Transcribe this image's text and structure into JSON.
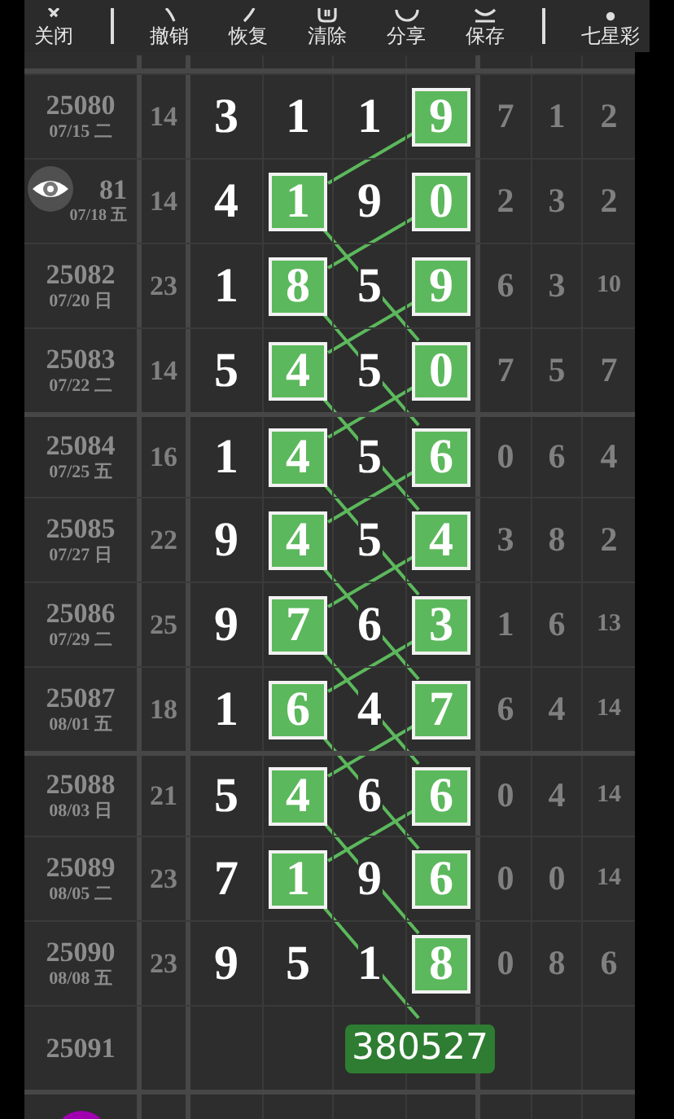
{
  "toolbar": [
    {
      "label": "关闭",
      "separated": true
    },
    {
      "label": "撤销",
      "separated": false
    },
    {
      "label": "恢复",
      "separated": false
    },
    {
      "label": "清除",
      "separated": false
    },
    {
      "label": "分享",
      "separated": false
    },
    {
      "label": "保存",
      "separated": true
    },
    {
      "label": "七星彩",
      "separated": false
    }
  ],
  "rows": [
    {
      "issue": "25080",
      "date": "07/15 二",
      "sum": "14",
      "digits": [
        {
          "value": "3",
          "highlighted": false
        },
        {
          "value": "1",
          "highlighted": false
        },
        {
          "value": "1",
          "highlighted": false
        },
        {
          "value": "9",
          "highlighted": true
        }
      ],
      "tail": [
        "7",
        "1",
        "2"
      ]
    },
    {
      "issue": "81",
      "eye_button": true,
      "date": "07/18 五",
      "sum": "14",
      "digits": [
        {
          "value": "4",
          "highlighted": false
        },
        {
          "value": "1",
          "highlighted": true
        },
        {
          "value": "9",
          "highlighted": false
        },
        {
          "value": "0",
          "highlighted": true
        }
      ],
      "tail": [
        "2",
        "3",
        "2"
      ]
    },
    {
      "issue": "25082",
      "date": "07/20 日",
      "sum": "23",
      "digits": [
        {
          "value": "1",
          "highlighted": false
        },
        {
          "value": "8",
          "highlighted": true
        },
        {
          "value": "5",
          "highlighted": false
        },
        {
          "value": "9",
          "highlighted": true
        }
      ],
      "tail": [
        "6",
        "3",
        "10"
      ]
    },
    {
      "issue": "25083",
      "date": "07/22 二",
      "sum": "14",
      "digits": [
        {
          "value": "5",
          "highlighted": false
        },
        {
          "value": "4",
          "highlighted": true
        },
        {
          "value": "5",
          "highlighted": false
        },
        {
          "value": "0",
          "highlighted": true
        }
      ],
      "tail": [
        "7",
        "5",
        "7"
      ]
    },
    {
      "issue": "25084",
      "date": "07/25 五",
      "sum": "16",
      "digits": [
        {
          "value": "1",
          "highlighted": false
        },
        {
          "value": "4",
          "highlighted": true
        },
        {
          "value": "5",
          "highlighted": false
        },
        {
          "value": "6",
          "highlighted": true
        }
      ],
      "tail": [
        "0",
        "6",
        "4"
      ]
    },
    {
      "issue": "25085",
      "date": "07/27 日",
      "sum": "22",
      "digits": [
        {
          "value": "9",
          "highlighted": false
        },
        {
          "value": "4",
          "highlighted": true
        },
        {
          "value": "5",
          "highlighted": false
        },
        {
          "value": "4",
          "highlighted": true
        }
      ],
      "tail": [
        "3",
        "8",
        "2"
      ]
    },
    {
      "issue": "25086",
      "date": "07/29 二",
      "sum": "25",
      "digits": [
        {
          "value": "9",
          "highlighted": false
        },
        {
          "value": "7",
          "highlighted": true
        },
        {
          "value": "6",
          "highlighted": false
        },
        {
          "value": "3",
          "highlighted": true
        }
      ],
      "tail": [
        "1",
        "6",
        "13"
      ]
    },
    {
      "issue": "25087",
      "date": "08/01 五",
      "sum": "18",
      "digits": [
        {
          "value": "1",
          "highlighted": false
        },
        {
          "value": "6",
          "highlighted": true
        },
        {
          "value": "4",
          "highlighted": false
        },
        {
          "value": "7",
          "highlighted": true
        }
      ],
      "tail": [
        "6",
        "4",
        "14"
      ]
    },
    {
      "issue": "25088",
      "date": "08/03 日",
      "sum": "21",
      "digits": [
        {
          "value": "5",
          "highlighted": false
        },
        {
          "value": "4",
          "highlighted": true
        },
        {
          "value": "6",
          "highlighted": false
        },
        {
          "value": "6",
          "highlighted": true
        }
      ],
      "tail": [
        "0",
        "4",
        "14"
      ]
    },
    {
      "issue": "25089",
      "date": "08/05 二",
      "sum": "23",
      "digits": [
        {
          "value": "7",
          "highlighted": false
        },
        {
          "value": "1",
          "highlighted": true
        },
        {
          "value": "9",
          "highlighted": false
        },
        {
          "value": "6",
          "highlighted": true
        }
      ],
      "tail": [
        "0",
        "0",
        "14"
      ]
    },
    {
      "issue": "25090",
      "date": "08/08 五",
      "sum": "23",
      "digits": [
        {
          "value": "9",
          "highlighted": false
        },
        {
          "value": "5",
          "highlighted": false
        },
        {
          "value": "1",
          "highlighted": false
        },
        {
          "value": "8",
          "highlighted": true
        }
      ],
      "tail": [
        "0",
        "8",
        "6"
      ]
    },
    {
      "issue": "25091",
      "prediction": "380527"
    }
  ]
}
